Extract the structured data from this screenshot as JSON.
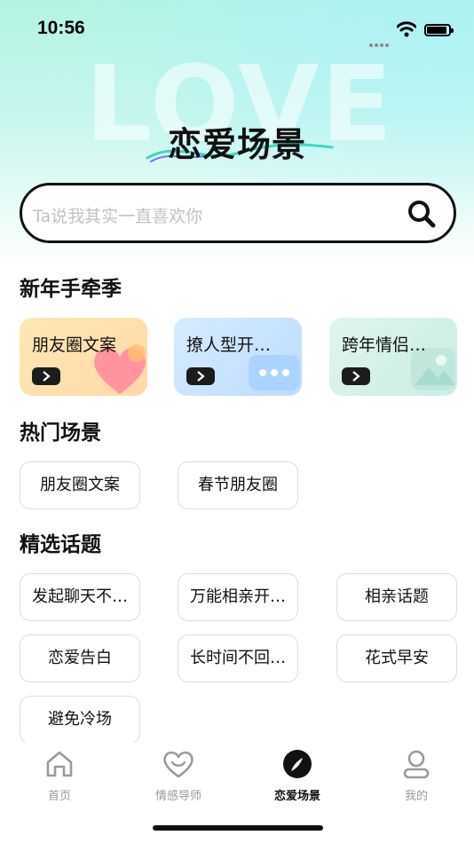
{
  "status_bar": {
    "time": "10:56"
  },
  "hero": {
    "decor_word": "LOVE",
    "title": "恋爱场景"
  },
  "search": {
    "placeholder": "Ta说我其实一直喜欢你"
  },
  "sections": {
    "new_year": "新年手牵季",
    "hot": "热门场景",
    "featured": "精选话题"
  },
  "promo_cards": [
    {
      "label": "朋友圈文案",
      "color": "#ffe3b0"
    },
    {
      "label": "撩人型开…",
      "color": "#cfe6ff"
    },
    {
      "label": "跨年情侣…",
      "color": "#d8f3ea"
    }
  ],
  "hot_chips": [
    "朋友圈文案",
    "春节朋友圈"
  ],
  "topic_chips": [
    "发起聊天不…",
    "万能相亲开…",
    "相亲话题",
    "恋爱告白",
    "长时间不回…",
    "花式早安",
    "避免冷场"
  ],
  "tabs": [
    {
      "label": "首页",
      "icon": "home-icon",
      "active": false
    },
    {
      "label": "情感导师",
      "icon": "heart-smile-icon",
      "active": false
    },
    {
      "label": "恋爱场景",
      "icon": "compass-icon",
      "active": true
    },
    {
      "label": "我的",
      "icon": "profile-icon",
      "active": false
    }
  ]
}
